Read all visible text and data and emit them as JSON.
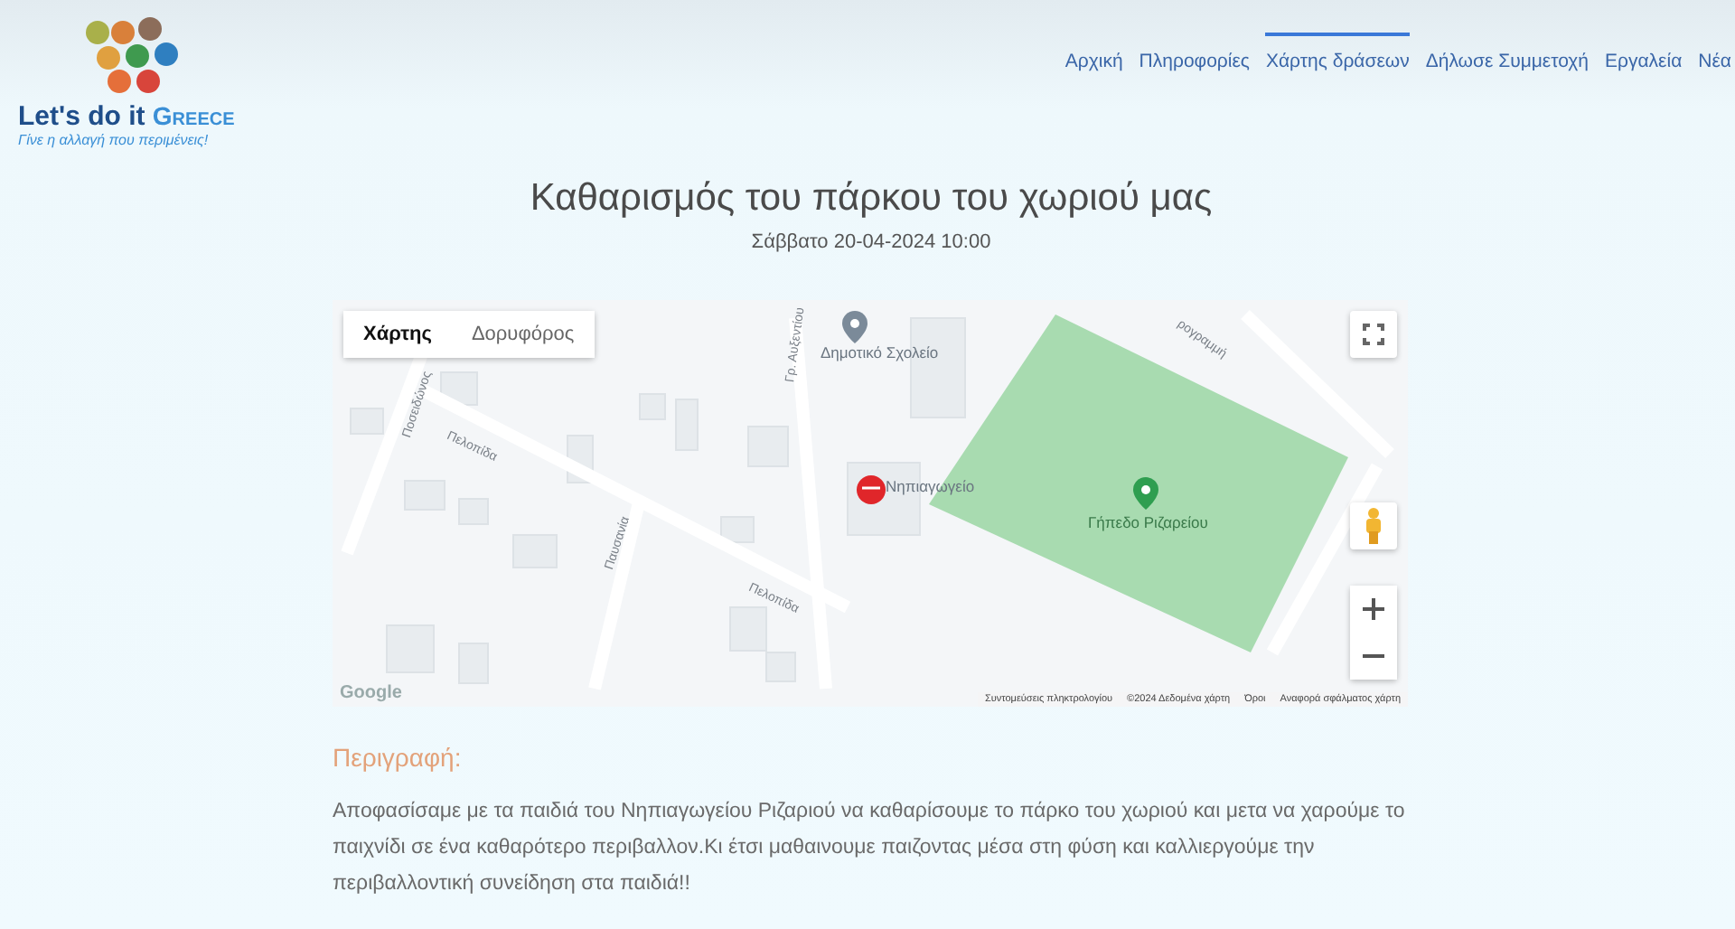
{
  "logo": {
    "name_main": "Let's do it",
    "name_accent": "Greece",
    "tagline": "Γίνε η αλλαγή που περιμένεις!"
  },
  "nav": [
    {
      "label": "Αρχική",
      "selected": false
    },
    {
      "label": "Πληροφορίες",
      "selected": false
    },
    {
      "label": "Χάρτης δράσεων",
      "selected": true
    },
    {
      "label": "Δήλωσε Συμμετοχή",
      "selected": false
    },
    {
      "label": "Εργαλεία",
      "selected": false
    },
    {
      "label": "Νέα",
      "selected": false
    }
  ],
  "event": {
    "title": "Καθαρισμός του πάρκου του χωριού μας",
    "datetime": "Σάββατο 20-04-2024 10:00"
  },
  "map": {
    "tabs": [
      {
        "label": "Χάρτης",
        "selected": true
      },
      {
        "label": "Δορυφόρος",
        "selected": false
      }
    ],
    "streets": [
      {
        "label": "Ποσειδώνος"
      },
      {
        "label": "Πελοπίδα"
      },
      {
        "label": "Πελοπίδα"
      },
      {
        "label": "Παυσανία"
      },
      {
        "label": "Γρ. Αυξεντίου"
      },
      {
        "label": "ρογραμμή"
      }
    ],
    "places": [
      {
        "kind": "school",
        "label": "Δημοτικό Σχολείο"
      },
      {
        "kind": "kindergarten",
        "label": "Νηπιαγωγείο"
      },
      {
        "kind": "park",
        "label": "Γήπεδο Ριζαρείου"
      }
    ],
    "brand": "Google",
    "footer": [
      "Συντομεύσεις πληκτρολογίου",
      "©2024 Δεδομένα χάρτη",
      "Όροι",
      "Αναφορά σφάλματος χάρτη"
    ]
  },
  "description": {
    "heading": "Περιγραφή:",
    "text": "Αποφασίσαμε με τα παιδιά του Νηπιαγωγείου Ριζαριού να καθαρίσουμε το πάρκο του χωριού και μετα να χαρούμε το παιχνίδι σε ένα καθαρότερο περιβαλλον.Κι έτσι μαθαινουμε παιζοντας μέσα στη φύση και καλλιεργούμε την περιβαλλοντική συνείδηση στα παιδιά!!"
  }
}
